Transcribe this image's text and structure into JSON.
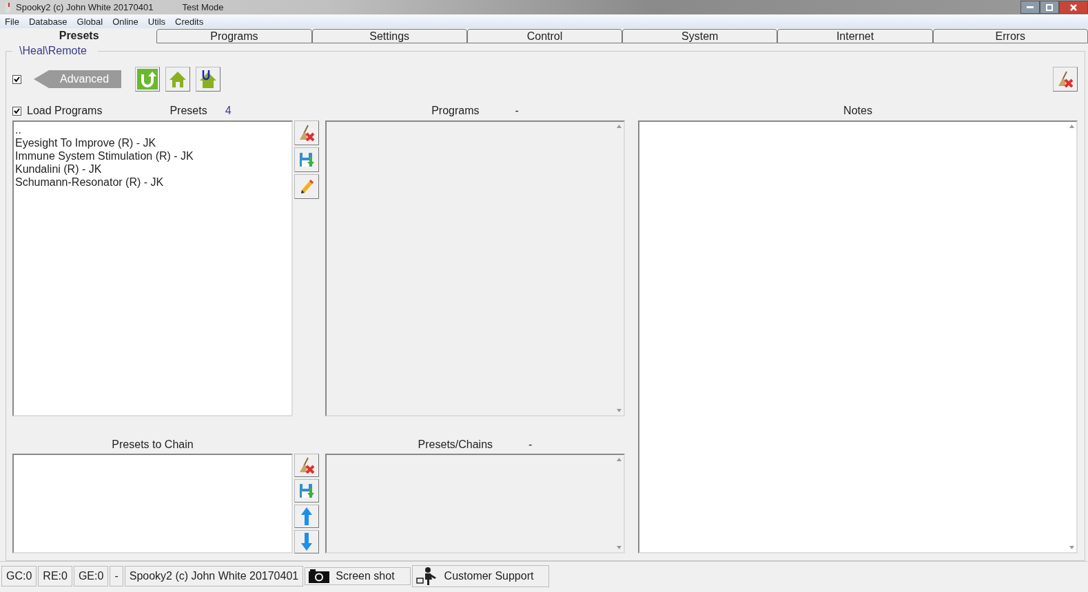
{
  "window": {
    "title": "Spooky2 (c) John White 20170401",
    "mode": "Test Mode"
  },
  "menu": [
    "File",
    "Database",
    "Global",
    "Online",
    "Utils",
    "Credits"
  ],
  "tabs": [
    {
      "label": "Presets",
      "selected": true
    },
    {
      "label": "Programs",
      "selected": false
    },
    {
      "label": "Settings",
      "selected": false
    },
    {
      "label": "Control",
      "selected": false
    },
    {
      "label": "System",
      "selected": false
    },
    {
      "label": "Internet",
      "selected": false
    },
    {
      "label": "Errors",
      "selected": false
    }
  ],
  "group": {
    "title": "\\Heal\\Remote"
  },
  "advanced": {
    "checked": true,
    "label": "Advanced"
  },
  "load_programs": {
    "label": "Load Programs",
    "checked": true
  },
  "presets": {
    "label": "Presets",
    "count": "4",
    "items": [
      "..",
      "Eyesight To Improve (R) - JK",
      "Immune System Stimulation (R) - JK",
      "Kundalini (R) - JK",
      "Schumann-Resonator (R) - JK"
    ]
  },
  "programs": {
    "label": "Programs",
    "count": "-"
  },
  "notes": {
    "label": "Notes"
  },
  "presets_to_chain": {
    "label": "Presets to Chain"
  },
  "presets_chains": {
    "label": "Presets/Chains",
    "count": "-"
  },
  "status_bar": {
    "cells": [
      "GC:0",
      "RE:0",
      "GE:0",
      "-",
      "Spooky2 (c) John White 20170401"
    ],
    "screenshot": "Screen shot",
    "support": "Customer Support"
  }
}
